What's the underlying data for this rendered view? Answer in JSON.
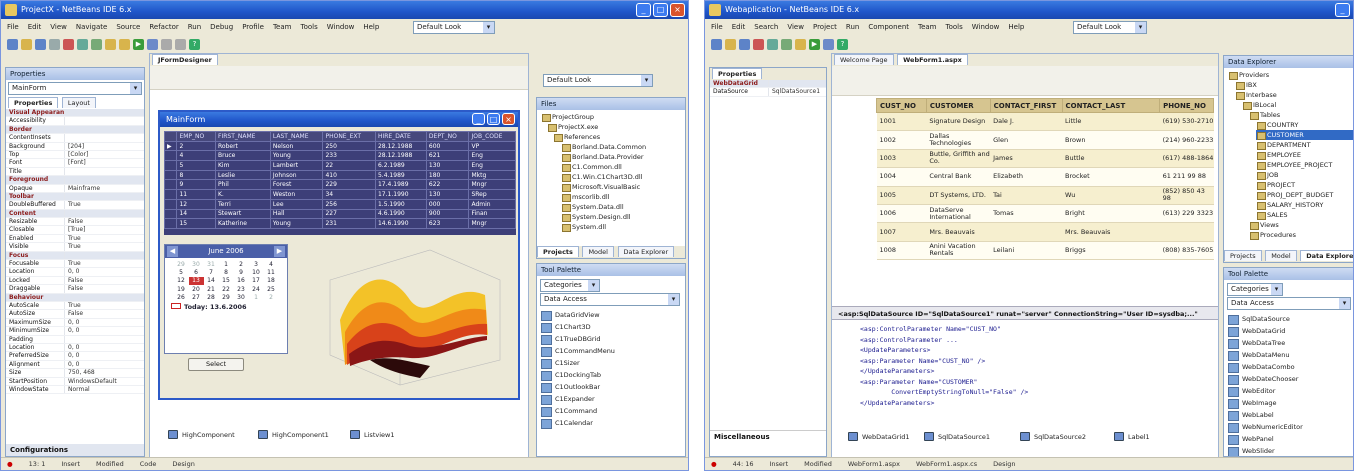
{
  "left_window": {
    "title": "ProjectX - NetBeans IDE 6.x",
    "menu": [
      "File",
      "Edit",
      "View",
      "Navigate",
      "Source",
      "Refactor",
      "Run",
      "Debug",
      "Profile",
      "Team",
      "Tools",
      "Window",
      "Help"
    ],
    "look_combo": "Default Look",
    "editor_tab": "JFormDesigner",
    "palette_combo": "Default Look",
    "properties": {
      "header": "Properties",
      "object": "MainForm",
      "tabs": [
        "Properties",
        "Layout"
      ],
      "rows": [
        {
          "k": "Visual Appearance",
          "v": "",
          "cat": true
        },
        {
          "k": "Accessibility",
          "v": ""
        },
        {
          "k": "Border",
          "v": "",
          "cat": true
        },
        {
          "k": "ContentInsets",
          "v": ""
        },
        {
          "k": "Background",
          "v": "[204]"
        },
        {
          "k": "Top",
          "v": "[Color]"
        },
        {
          "k": "Font",
          "v": "[Font]"
        },
        {
          "k": "Title",
          "v": ""
        },
        {
          "k": "Foreground",
          "v": "",
          "cat": true
        },
        {
          "k": "Opaque",
          "v": "Mainframe"
        },
        {
          "k": "Toolbar",
          "v": "",
          "cat": true
        },
        {
          "k": "DoubleBuffered",
          "v": "True"
        },
        {
          "k": "Content",
          "v": "",
          "cat": true
        },
        {
          "k": "Resizable",
          "v": "False"
        },
        {
          "k": "Closable",
          "v": "[True]"
        },
        {
          "k": "Enabled",
          "v": "True"
        },
        {
          "k": "Visible",
          "v": "True"
        },
        {
          "k": "Focus",
          "v": "",
          "cat": true
        },
        {
          "k": "Focusable",
          "v": "True"
        },
        {
          "k": "Location",
          "v": "0, 0"
        },
        {
          "k": "Locked",
          "v": "False"
        },
        {
          "k": "Draggable",
          "v": "False"
        },
        {
          "k": "Behaviour",
          "v": "",
          "cat": true
        },
        {
          "k": "AutoScale",
          "v": "True"
        },
        {
          "k": "AutoSize",
          "v": "False"
        },
        {
          "k": "MaximumSize",
          "v": "0, 0"
        },
        {
          "k": "MinimumSize",
          "v": "0, 0"
        },
        {
          "k": "Padding",
          "v": ""
        },
        {
          "k": "Location",
          "v": "0, 0"
        },
        {
          "k": "PreferredSize",
          "v": "0, 0"
        },
        {
          "k": "Alignment",
          "v": "0, 0"
        },
        {
          "k": "Size",
          "v": "750, 468"
        },
        {
          "k": "StartPosition",
          "v": "WindowsDefault"
        },
        {
          "k": "WindowState",
          "v": "Normal"
        }
      ],
      "footer": "Configurations"
    },
    "form": {
      "title": "MainForm",
      "columns": [
        "EMP_NO",
        "FIRST_NAME",
        "LAST_NAME",
        "PHONE_EXT",
        "HIRE_DATE",
        "DEPT_NO",
        "JOB_CODE"
      ],
      "rows": [
        [
          "2",
          "Robert",
          "Nelson",
          "250",
          "28.12.1988",
          "600",
          "VP"
        ],
        [
          "4",
          "Bruce",
          "Young",
          "233",
          "28.12.1988",
          "621",
          "Eng"
        ],
        [
          "5",
          "Kim",
          "Lambert",
          "22",
          "6.2.1989",
          "130",
          "Eng"
        ],
        [
          "8",
          "Leslie",
          "Johnson",
          "410",
          "5.4.1989",
          "180",
          "Mktg"
        ],
        [
          "9",
          "Phil",
          "Forest",
          "229",
          "17.4.1989",
          "622",
          "Mngr"
        ],
        [
          "11",
          "K.",
          "Weston",
          "34",
          "17.1.1990",
          "130",
          "SRep"
        ],
        [
          "12",
          "Terri",
          "Lee",
          "256",
          "1.5.1990",
          "000",
          "Admin"
        ],
        [
          "14",
          "Stewart",
          "Hall",
          "227",
          "4.6.1990",
          "900",
          "Finan"
        ],
        [
          "15",
          "Katherine",
          "Young",
          "231",
          "14.6.1990",
          "623",
          "Mngr"
        ]
      ],
      "calendar": {
        "month": "June 2006",
        "weeks": [
          [
            "29",
            "30",
            "31",
            "1",
            "2",
            "3",
            "4"
          ],
          [
            "5",
            "6",
            "7",
            "8",
            "9",
            "10",
            "11"
          ],
          [
            "12",
            "13",
            "14",
            "15",
            "16",
            "17",
            "18"
          ],
          [
            "19",
            "20",
            "21",
            "22",
            "23",
            "24",
            "25"
          ],
          [
            "26",
            "27",
            "28",
            "29",
            "30",
            "1",
            "2"
          ]
        ],
        "today_label": "Today: 13.6.2006",
        "button": "Select"
      },
      "designer_tabs": [
        "HighComponent",
        "HighComponent1",
        "Listview1"
      ]
    },
    "files_panel": {
      "header": "Files",
      "items": [
        "ProjectGroup",
        "ProjectX.exe",
        "References",
        "Borland.Data.Common",
        "Borland.Data.Provider",
        "C1.Common.dll",
        "C1.Win.C1Chart3D.dll",
        "Microsoft.VisualBasic",
        "mscorlib.dll",
        "System.Data.dll",
        "System.Design.dll",
        "System.dll"
      ],
      "tabs": [
        "Projects",
        "Model",
        "Data Explorer"
      ]
    },
    "tool_palette": {
      "header": "Tool Palette",
      "category": "Categories",
      "search": "Data Access",
      "items": [
        "DataGridView",
        "C1Chart3D",
        "C1TrueDBGrid",
        "C1CommandMenu",
        "C1Sizer",
        "C1DockingTab",
        "C1OutlookBar",
        "C1Expander",
        "C1Command",
        "C1Calendar"
      ]
    },
    "status": [
      "Insert",
      "Modified",
      "Code",
      "Design"
    ],
    "status_pos": "13: 1"
  },
  "right_window": {
    "title": "Webaplication - NetBeans IDE 6.x",
    "menu": [
      "File",
      "Edit",
      "Search",
      "View",
      "Project",
      "Run",
      "Component",
      "Team",
      "Tools",
      "Window",
      "Help"
    ],
    "look_combo": "Default Look",
    "editor_tabs": [
      "Welcome Page",
      "WebForm1.aspx"
    ],
    "properties": {
      "header": "Properties",
      "tabs": [
        "Properties"
      ],
      "rows": [
        {
          "k": "WebDataGrid",
          "v": "",
          "cat": true
        },
        {
          "k": "DataSource",
          "v": "SqlDataSource1"
        }
      ],
      "footer": "Miscellaneous"
    },
    "grid": {
      "columns": [
        "CUST_NO",
        "CUSTOMER",
        "CONTACT_FIRST",
        "CONTACT_LAST",
        "PHONE_NO"
      ],
      "rows": [
        [
          "1001",
          "Signature Design",
          "Dale J.",
          "Little",
          "(619) 530-2710"
        ],
        [
          "1002",
          "Dallas Technologies",
          "Glen",
          "Brown",
          "(214) 960-2233"
        ],
        [
          "1003",
          "Buttle, Griffith and Co.",
          "James",
          "Buttle",
          "(617) 488-1864"
        ],
        [
          "1004",
          "Central Bank",
          "Elizabeth",
          "Brocket",
          "61 211 99 88"
        ],
        [
          "1005",
          "DT Systems, LTD.",
          "Tai",
          "Wu",
          "(852) 850 43 98"
        ],
        [
          "1006",
          "DataServe International",
          "Tomas",
          "Bright",
          "(613) 229 3323"
        ],
        [
          "1007",
          "Mrs. Beauvais",
          "",
          "Mrs. Beauvais",
          ""
        ],
        [
          "1008",
          "Anini Vacation Rentals",
          "Leilani",
          "Briggs",
          "(808) 835-7605"
        ]
      ]
    },
    "source_header": "<asp:SqlDataSource ID=\"SqlDataSource1\" runat=\"server\" ConnectionString=\"User ID=sysdba;...\"",
    "code_lines": [
      "<asp:ControlParameter Name=\"CUST_NO\"",
      "<asp:ControlParameter ...",
      "<UpdateParameters>",
      "<asp:Parameter Name=\"CUST_NO\" />",
      "</UpdateParameters>",
      "<asp:Parameter Name=\"CUSTOMER\"",
      "        ConvertEmptyStringToNull=\"False\" />",
      "</UpdateParameters>"
    ],
    "designer_tabs": [
      "WebDataGrid1",
      "SqlDataSource1",
      "SqlDataSource2",
      "Label1"
    ],
    "server_tree": {
      "header": "Data Explorer",
      "items": [
        "Providers",
        "IBX",
        "Interbase",
        "IBLocal",
        "Tables",
        "COUNTRY",
        "CUSTOMER",
        "DEPARTMENT",
        "EMPLOYEE",
        "EMPLOYEE_PROJECT",
        "JOB",
        "PROJECT",
        "PROJ_DEPT_BUDGET",
        "SALARY_HISTORY",
        "SALES",
        "Views",
        "Procedures"
      ],
      "tabs": [
        "Projects",
        "Model",
        "Data Explorer"
      ]
    },
    "tool_palette": {
      "header": "Tool Palette",
      "category": "Categories",
      "search": "Data Access",
      "items": [
        "SqlDataSource",
        "WebDataGrid",
        "WebDataTree",
        "WebDataMenu",
        "WebDataCombo",
        "WebDateChooser",
        "WebEditor",
        "WebImage",
        "WebLabel",
        "WebNumericEditor",
        "WebPanel",
        "WebSlider"
      ]
    },
    "status": [
      "Insert",
      "Modified",
      "WebForm1.aspx",
      "WebForm1.aspx.cs",
      "Design"
    ],
    "status_pos": "44: 16"
  },
  "colors": {
    "titlebar": "#1f55c9",
    "grid_header": "#46487c",
    "grid_cell": "#3d3f78",
    "db_header": "#d6c590",
    "db_odd": "#f6efcf",
    "category_text": "#8b1a1a"
  }
}
